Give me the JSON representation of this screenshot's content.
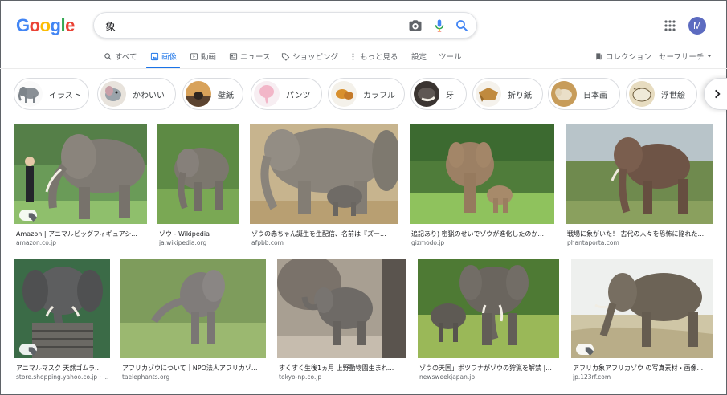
{
  "logo": {
    "letters": [
      "G",
      "o",
      "o",
      "g",
      "l",
      "e"
    ],
    "colors": [
      "#4285F4",
      "#EA4335",
      "#FBBC05",
      "#4285F4",
      "#34A853",
      "#EA4335"
    ]
  },
  "search": {
    "query": "象"
  },
  "account": {
    "initial": "M",
    "color": "#5c6bc0"
  },
  "tabs": [
    {
      "label": "すべて",
      "icon": "search-icon"
    },
    {
      "label": "画像",
      "icon": "image-icon",
      "active": true
    },
    {
      "label": "動画",
      "icon": "video-icon"
    },
    {
      "label": "ニュース",
      "icon": "news-icon"
    },
    {
      "label": "ショッピング",
      "icon": "tag-icon"
    },
    {
      "label": "もっと見る",
      "icon": "more-vert-icon"
    },
    {
      "label": "設定"
    },
    {
      "label": "ツール"
    }
  ],
  "right_tabs": {
    "collection": "コレクション",
    "safesearch": "セーフサーチ"
  },
  "chips": [
    "イラスト",
    "かわいい",
    "壁紙",
    "パンツ",
    "カラフル",
    "牙",
    "折り紙",
    "日本画",
    "浮世絵"
  ],
  "results_row1": [
    {
      "title": "Amazon | アニマルビッグフィギュアシ...",
      "domain": "amazon.co.jp"
    },
    {
      "title": "ゾウ - Wikipedia",
      "domain": "ja.wikipedia.org"
    },
    {
      "title": "ゾウの赤ちゃん誕生を生配信、名前は『ズー...",
      "domain": "afpbb.com"
    },
    {
      "title": "追記あり) 密猟のせいでゾウが進化したのか...",
      "domain": "gizmodo.jp"
    },
    {
      "title": "戦場に象がいた！ 古代の人々を恐怖に陥れた...",
      "domain": "phantaporta.com"
    }
  ],
  "results_row2": [
    {
      "title": "アニマルマスク 天然ゴムラ...",
      "domain": "store.shopping.yahoo.co.jp · ..."
    },
    {
      "title": "アフリカゾウについて｜NPO法人アフリカゾ...",
      "domain": "taelephants.org"
    },
    {
      "title": "すくすく生後1ヵ月 上野動物園生まれ...",
      "domain": "tokyo-np.co.jp"
    },
    {
      "title": "ゾウの天国」ボツワナがゾウの狩猟を解禁 |...",
      "domain": "newsweekjapan.jp"
    },
    {
      "title": "アフリカ象アフリカゾウ の写真素材・画像...",
      "domain": "jp.123rf.com"
    }
  ]
}
